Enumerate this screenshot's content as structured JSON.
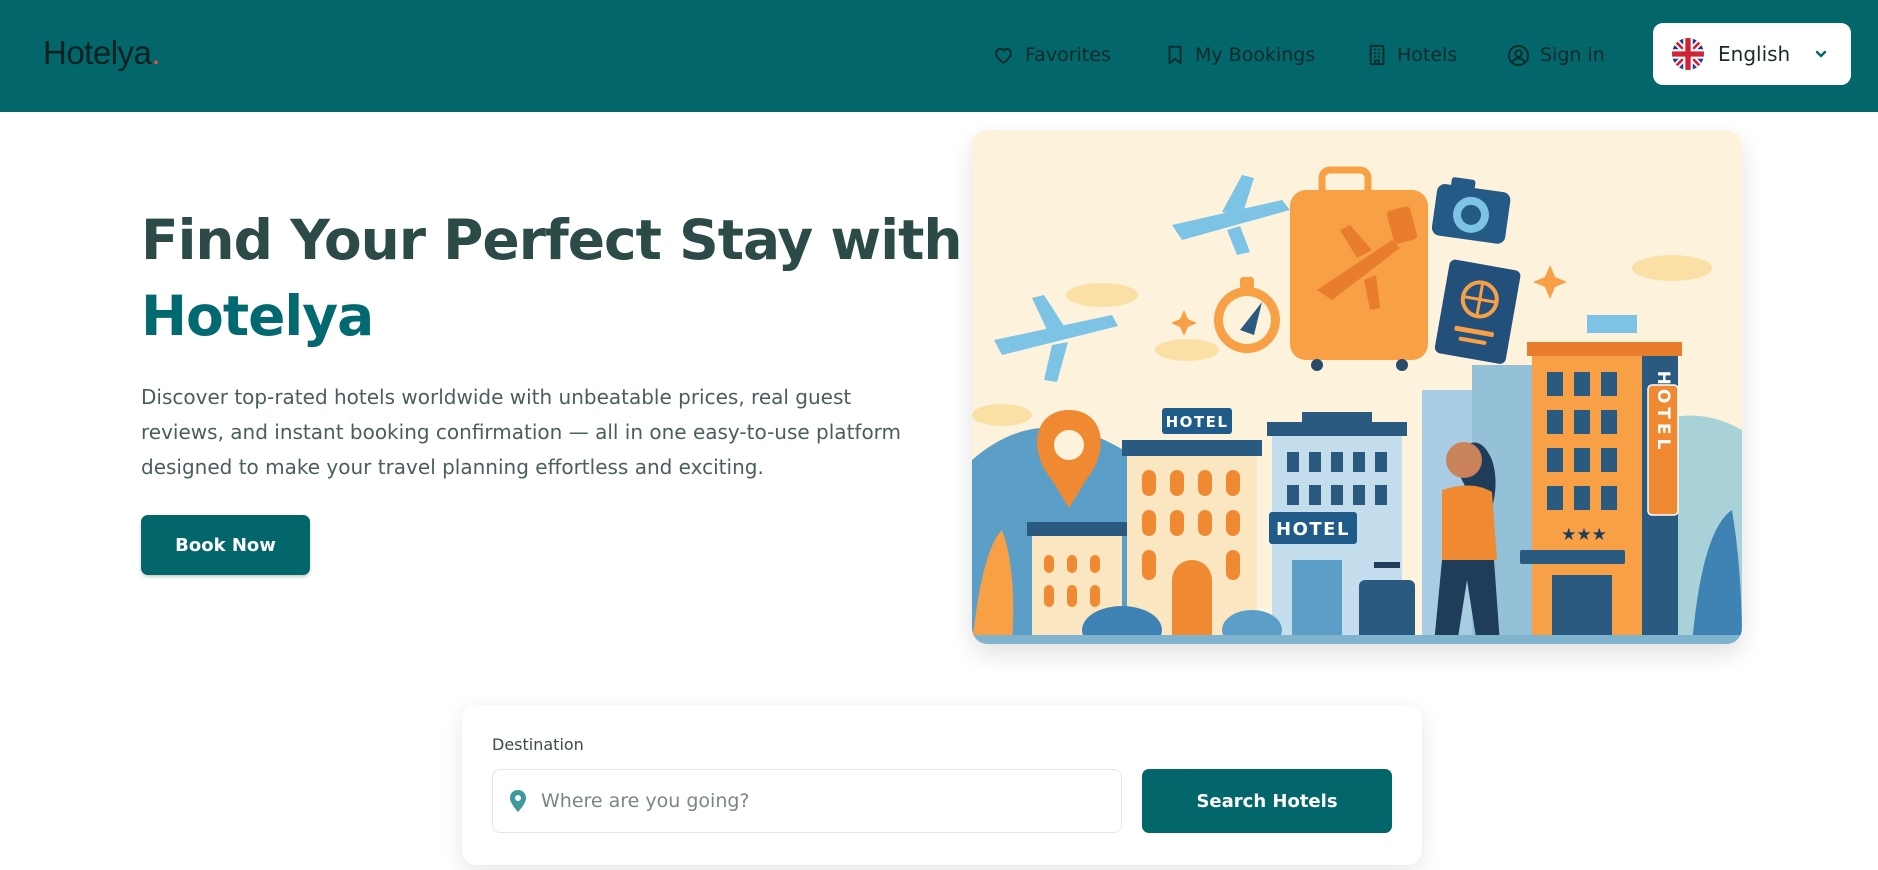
{
  "header": {
    "logo_text": "Hotelya",
    "logo_dot": ".",
    "nav": {
      "favorites": "Favorites",
      "my_bookings": "My Bookings",
      "hotels": "Hotels",
      "sign_in": "Sign in"
    },
    "language": {
      "selected": "English",
      "flag_icon": "uk-flag-icon"
    }
  },
  "hero": {
    "title_line1": "Find Your Perfect Stay with",
    "title_brand": "Hotelya",
    "description": "Discover top-rated hotels worldwide with unbeatable prices, real guest reviews, and instant booking confirmation — all in one easy-to-use platform designed to make your travel planning effortless and exciting.",
    "cta_label": "Book Now"
  },
  "illustration": {
    "sign_top": "HOTEL",
    "sign_middle": "HOTEL",
    "sign_vertical": "HOTEL",
    "stars": "★★★"
  },
  "search": {
    "destination_label": "Destination",
    "destination_placeholder": "Where are you going?",
    "destination_value": "",
    "button_label": "Search Hotels"
  },
  "colors": {
    "brand_teal": "#02666b",
    "accent_orange": "#f7a046",
    "logo_dot": "#e5533c"
  }
}
